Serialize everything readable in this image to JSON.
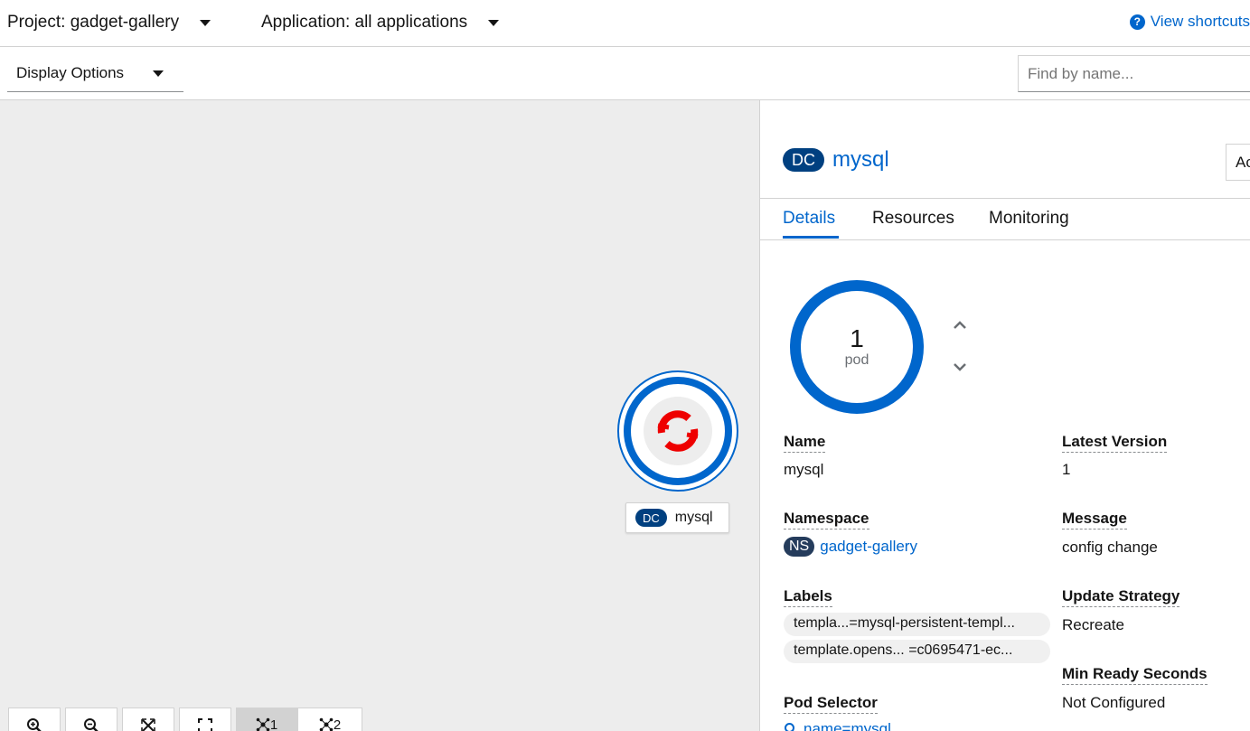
{
  "header": {
    "project_label": "Project: gadget-gallery",
    "application_label": "Application: all applications",
    "shortcuts_label": "View shortcuts"
  },
  "toolbar": {
    "display_options_label": "Display Options",
    "find_placeholder": "Find by name..."
  },
  "topology": {
    "node": {
      "kind_badge": "DC",
      "name": "mysql"
    },
    "controls": [
      {
        "name": "zoom-in",
        "label": ""
      },
      {
        "name": "zoom-out",
        "label": ""
      },
      {
        "name": "fit-to-screen",
        "label": ""
      },
      {
        "name": "reset-view",
        "label": ""
      },
      {
        "name": "layout-1",
        "label": "1",
        "selected": true
      },
      {
        "name": "layout-2",
        "label": "2",
        "selected": false
      }
    ]
  },
  "panel": {
    "kind_badge": "DC",
    "title": "mysql",
    "actions_label": "Actions",
    "tabs": [
      "Details",
      "Resources",
      "Monitoring"
    ],
    "active_tab": "Details",
    "pods": {
      "count": "1",
      "unit": "pod"
    },
    "fields": {
      "name_label": "Name",
      "name_value": "mysql",
      "namespace_label": "Namespace",
      "namespace_badge": "NS",
      "namespace_value": "gadget-gallery",
      "labels_label": "Labels",
      "labels": [
        "templa...=mysql-persistent-templ...",
        "template.opens...  =c0695471-ec..."
      ],
      "pod_selector_label": "Pod Selector",
      "pod_selector_value": "name=mysql",
      "latest_version_label": "Latest Version",
      "latest_version_value": "1",
      "message_label": "Message",
      "message_value": "config change",
      "update_strategy_label": "Update Strategy",
      "update_strategy_value": "Recreate",
      "min_ready_label": "Min Ready Seconds",
      "min_ready_value": "Not Configured"
    }
  },
  "colors": {
    "accent": "#0066cc",
    "badge_bg": "#004080",
    "canvas_bg": "#ededed",
    "openshift_red": "#ee0000"
  }
}
